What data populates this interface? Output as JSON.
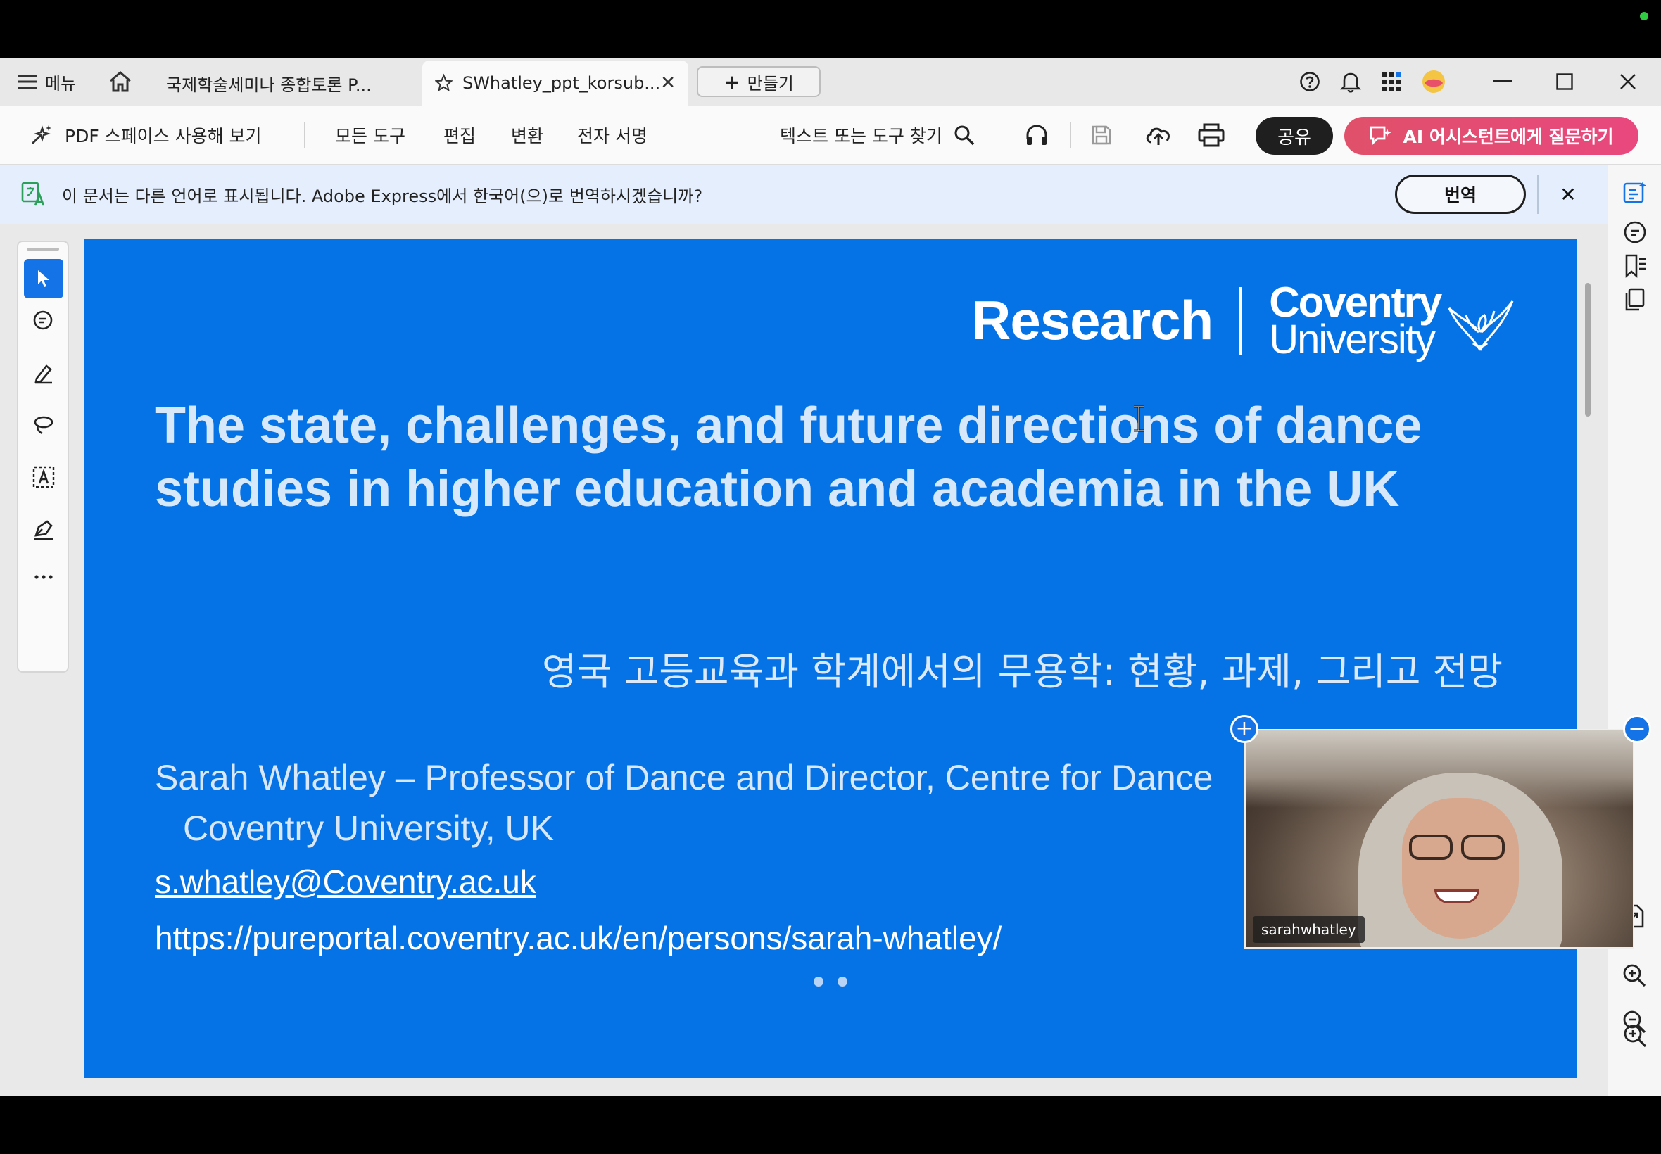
{
  "tabbar": {
    "menu_label": "메뉴",
    "tabs": [
      {
        "label": "국제학술세미나 종합토론 P..."
      },
      {
        "label": "SWhatley_ppt_korsub..."
      }
    ],
    "create_label": "만들기"
  },
  "toolbar": {
    "pdf_spaces_label": "PDF 스페이스 사용해 보기",
    "all_tools_label": "모든 도구",
    "edit_label": "편집",
    "convert_label": "변환",
    "esign_label": "전자 서명",
    "search_label": "텍스트 또는 도구 찾기",
    "share_label": "공유",
    "ai_label": "AI 어시스턴트에게 질문하기"
  },
  "banner": {
    "message": "이 문서는 다른 언어로 표시됩니다. Adobe Express에서 한국어(으)로 번역하시겠습니까?",
    "translate_label": "번역"
  },
  "slide": {
    "brand_research": "Research",
    "brand_coventry": "Coventry",
    "brand_university": "University",
    "title": "The state, challenges, and future directions of dance studies in higher education and academia in the UK",
    "subtitle_kr": "영국 고등교육과 학계에서의 무용학: 현황, 과제, 그리고 전망",
    "author_line1": "Sarah Whatley – Professor of Dance and Director, Centre for Dance",
    "author_line2": "Coventry University, UK",
    "email": "s.whatley@Coventry.ac.uk",
    "url": "https://pureportal.coventry.ac.uk/en/persons/sarah-whatley/"
  },
  "video": {
    "participant_name": "sarahwhatley"
  },
  "colors": {
    "slide_bg": "#0573e6",
    "active_tool": "#1473e6",
    "ai_button": "#e9487e",
    "banner_bg": "#e4eefc"
  }
}
